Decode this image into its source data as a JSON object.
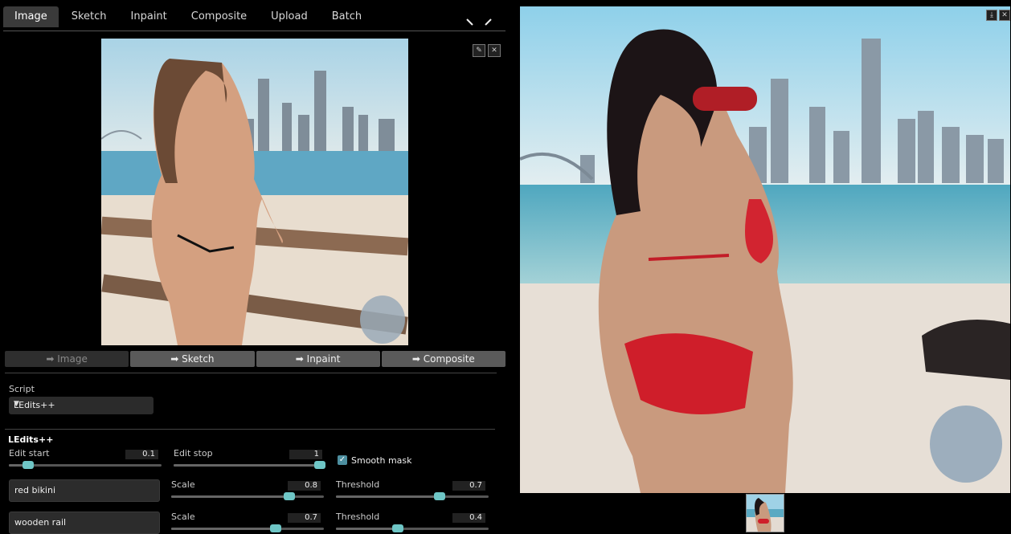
{
  "tabs": [
    {
      "label": "Image",
      "active": true
    },
    {
      "label": "Sketch",
      "active": false
    },
    {
      "label": "Inpaint",
      "active": false
    },
    {
      "label": "Composite",
      "active": false
    },
    {
      "label": "Upload",
      "active": false
    },
    {
      "label": "Batch",
      "active": false
    }
  ],
  "icons": {
    "tool1": "brush-icon",
    "tool2": "pencil-icon",
    "edit": "pencil-icon",
    "close": "close-icon",
    "download": "download-icon"
  },
  "send_buttons": [
    {
      "label": "➡ Image"
    },
    {
      "label": "➡ Sketch"
    },
    {
      "label": "➡ Inpaint"
    },
    {
      "label": "➡ Composite"
    }
  ],
  "script": {
    "label": "Script",
    "value": "LEdits++"
  },
  "ledits": {
    "title": "LEdits++",
    "edit_start": {
      "label": "Edit start",
      "value": "0.1",
      "fraction": 0.1
    },
    "edit_stop": {
      "label": "Edit stop",
      "value": "1",
      "fraction": 1.0
    },
    "smooth_mask": {
      "label": "Smooth mask",
      "checked": true
    },
    "prompts": [
      {
        "text": "red bikini",
        "scale": {
          "label": "Scale",
          "value": "0.8",
          "fraction": 0.8
        },
        "threshold": {
          "label": "Threshold",
          "value": "0.7",
          "fraction": 0.7
        }
      },
      {
        "text": "wooden rail",
        "scale": {
          "label": "Scale",
          "value": "0.7",
          "fraction": 0.7
        },
        "threshold": {
          "label": "Threshold",
          "value": "0.4",
          "fraction": 0.4
        }
      }
    ]
  },
  "colors": {
    "accent": "#6ec6c6",
    "checkbox": "#4d8fa0"
  }
}
